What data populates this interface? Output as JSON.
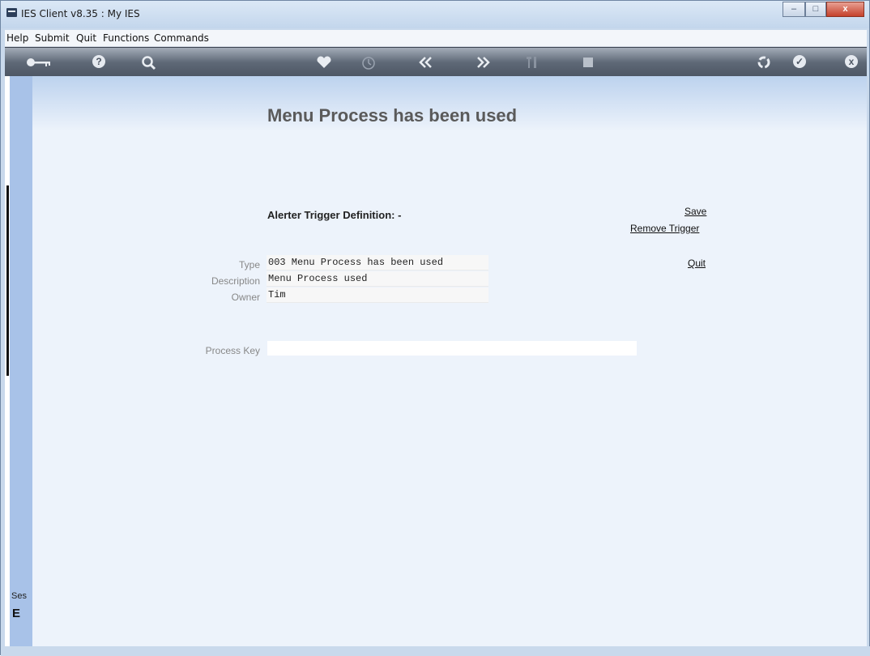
{
  "window": {
    "title": "IES Client v8.35 : My IES",
    "controls": {
      "minimize": "–",
      "maximize": "□",
      "close": "x"
    }
  },
  "menu": [
    "Help",
    "Submit",
    "Quit",
    "Functions",
    "Commands"
  ],
  "toolbar": {
    "icons": [
      "key-icon",
      "help-icon",
      "search-icon",
      "heart-icon",
      "clock-icon",
      "rewind-icon",
      "fast-forward-icon",
      "tools-icon",
      "stop-icon",
      "recycle-icon",
      "checkmark-icon",
      "close-icon"
    ],
    "colors": {
      "bar": "#5f6977",
      "icon": "#e9edf2"
    }
  },
  "sidebar": {
    "ses_label": "Ses",
    "glyph": "E"
  },
  "page": {
    "heading": "Menu Process has been used",
    "section_title": "Alerter Trigger Definition: -",
    "links": {
      "save": "Save",
      "remove_trigger": "Remove Trigger",
      "quit": "Quit"
    },
    "fields": {
      "type_label": "Type",
      "type_value": "003 Menu Process has been used",
      "description_label": "Description",
      "description_value": "Menu Process used",
      "owner_label": "Owner",
      "owner_value": "Tim",
      "process_key_label": "Process Key",
      "process_key_value": ""
    }
  },
  "colors": {
    "content_bg": "#edf3fb",
    "side_panel": "#a8c2e8",
    "heading": "#5a5a5a"
  }
}
